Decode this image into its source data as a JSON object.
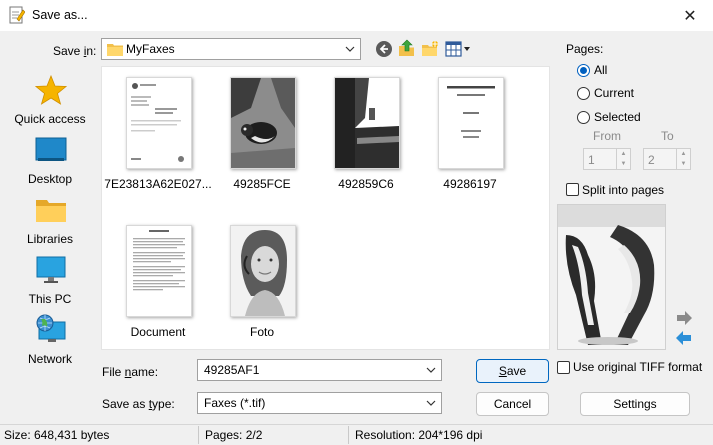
{
  "window": {
    "title": "Save as..."
  },
  "toolbar": {
    "save_in_label": "Save ",
    "save_in_key": "i",
    "save_in_suffix": "n:",
    "folder": "MyFaxes"
  },
  "places": [
    {
      "label": "Quick access",
      "icon": "star-icon"
    },
    {
      "label": "Desktop",
      "icon": "desktop-icon"
    },
    {
      "label": "Libraries",
      "icon": "folder-icon"
    },
    {
      "label": "This PC",
      "icon": "monitor-icon"
    },
    {
      "label": "Network",
      "icon": "network-icon"
    }
  ],
  "files": [
    {
      "name": "7E23813A62E027...",
      "kind": "letter"
    },
    {
      "name": "49285FCE",
      "kind": "photo-bird"
    },
    {
      "name": "492859C6",
      "kind": "photo-landscape"
    },
    {
      "name": "49286197",
      "kind": "cover"
    },
    {
      "name": "Document",
      "kind": "text"
    },
    {
      "name": "Foto",
      "kind": "portrait"
    }
  ],
  "form": {
    "file_name_label_pre": "File ",
    "file_name_label_key": "n",
    "file_name_label_post": "ame:",
    "file_name_value": "49285AF1",
    "save_type_label_pre": "Save as ",
    "save_type_label_key": "t",
    "save_type_label_post": "ype:",
    "save_type_value": "Faxes (*.tif)"
  },
  "buttons": {
    "save_pre": "",
    "save_key": "S",
    "save_post": "ave",
    "cancel": "Cancel",
    "settings": "Settings"
  },
  "pages": {
    "label": "Pages:",
    "all": "All",
    "current": "Current",
    "selected": "Selected",
    "from_label": "From",
    "to_label": "To",
    "from_value": "1",
    "to_value": "2",
    "split_label": "Split into pages",
    "selected_option": "All"
  },
  "tiff_option": {
    "label": "Use original TIFF format"
  },
  "status": {
    "size": "Size: 648,431 bytes",
    "pages": "Pages: 2/2",
    "resolution": "Resolution: 204*196 dpi"
  },
  "colors": {
    "accent": "#0067c0",
    "folder": "#f2c04b",
    "star": "#f6b400"
  }
}
